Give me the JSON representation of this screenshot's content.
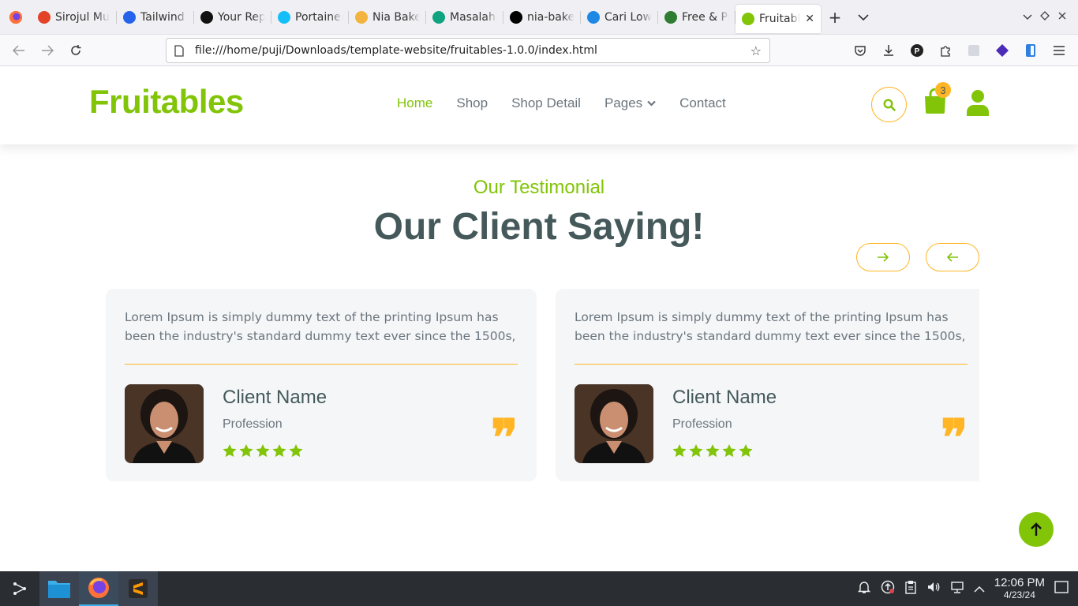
{
  "browser": {
    "tabs": [
      {
        "label": "Sirojul Mu",
        "icon": "gitlab-icon",
        "color": "#e24329"
      },
      {
        "label": "Tailwind CS",
        "icon": "tailwind-icon",
        "color": "#2563eb"
      },
      {
        "label": "Your Repo",
        "icon": "github-icon",
        "color": "#111111"
      },
      {
        "label": "Portainer |",
        "icon": "portainer-icon",
        "color": "#13bef9"
      },
      {
        "label": "Nia Bakery",
        "icon": "bakery-icon",
        "color": "#f3b43f"
      },
      {
        "label": "Masalah C",
        "icon": "chatgpt-icon",
        "color": "#10a37f"
      },
      {
        "label": "nia-bakery",
        "icon": "vercel-icon",
        "color": "#000000"
      },
      {
        "label": "Cari Lowon",
        "icon": "jobs-icon",
        "color": "#1e88e5"
      },
      {
        "label": "Free & Pre",
        "icon": "leaf-icon",
        "color": "#2e7d32"
      },
      {
        "label": "Fruitables - V",
        "icon": "page-icon",
        "color": "#81c408",
        "active": true
      }
    ],
    "url": "file:///home/puji/Downloads/template-website/fruitables-1.0.0/index.html"
  },
  "site": {
    "brand": "Fruitables",
    "menu": {
      "home": "Home",
      "shop": "Shop",
      "shop_detail": "Shop Detail",
      "pages": "Pages",
      "contact": "Contact"
    },
    "cart_count": "3",
    "accent": "#81c408",
    "secondary": "#ffb524"
  },
  "testimonial": {
    "kicker": "Our Testimonial",
    "title": "Our Client Saying!",
    "cards": [
      {
        "text": "Lorem Ipsum is simply dummy text of the printing Ipsum has been the industry's standard dummy text ever since the 1500s,",
        "name": "Client Name",
        "profession": "Profession",
        "rating": 5
      },
      {
        "text": "Lorem Ipsum is simply dummy text of the printing Ipsum has been the industry's standard dummy text ever since the 1500s,",
        "name": "Client Name",
        "profession": "Profession",
        "rating": 5
      }
    ]
  },
  "taskbar": {
    "time": "12:06 PM",
    "date": "4/23/24"
  }
}
